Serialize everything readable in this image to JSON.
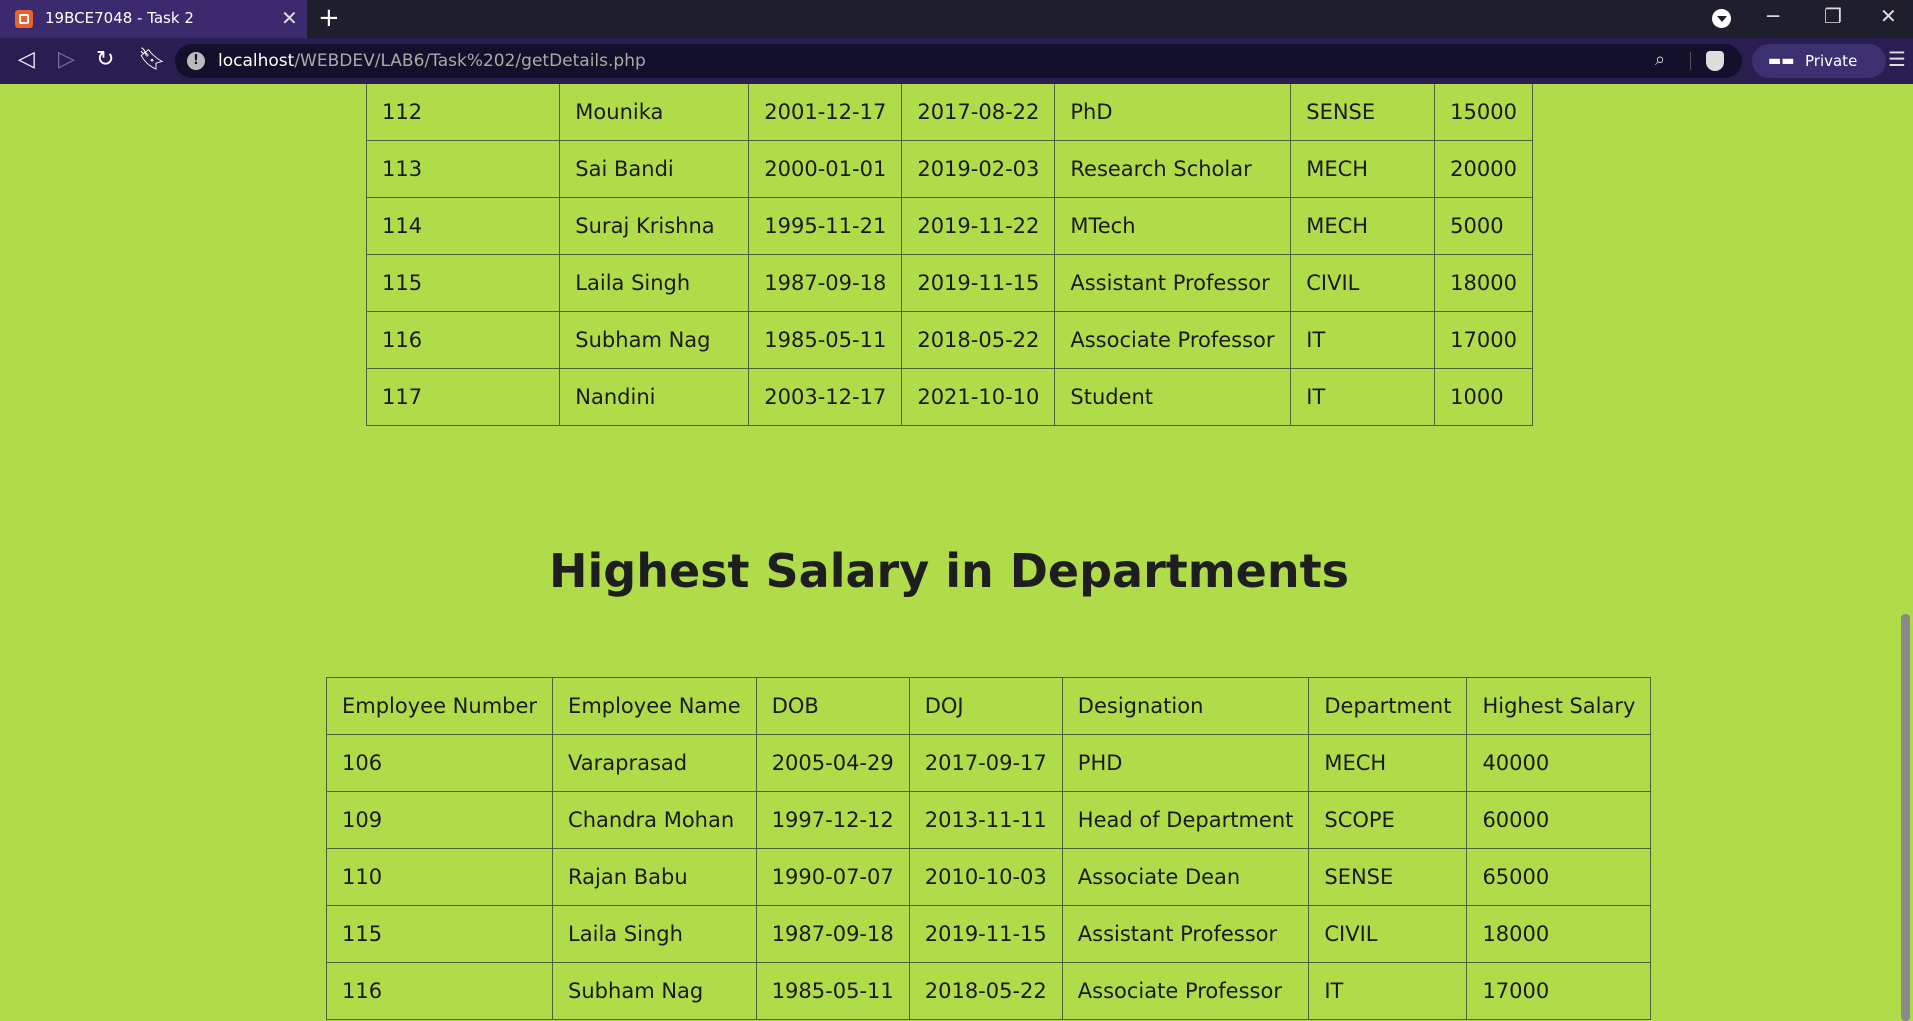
{
  "browser": {
    "tab_title": "19BCE7048 - Task 2",
    "url_host": "localhost",
    "url_path": "/WEBDEV/LAB6/Task%202/getDetails.php",
    "private_label": "Private"
  },
  "page": {
    "table1_rows": [
      [
        "112",
        "Mounika",
        "2001-12-17",
        "2017-08-22",
        "PhD",
        "SENSE",
        "15000"
      ],
      [
        "113",
        "Sai Bandi",
        "2000-01-01",
        "2019-02-03",
        "Research Scholar",
        "MECH",
        "20000"
      ],
      [
        "114",
        "Suraj Krishna",
        "1995-11-21",
        "2019-11-22",
        "MTech",
        "MECH",
        "5000"
      ],
      [
        "115",
        "Laila Singh",
        "1987-09-18",
        "2019-11-15",
        "Assistant Professor",
        "CIVIL",
        "18000"
      ],
      [
        "116",
        "Subham Nag",
        "1985-05-11",
        "2018-05-22",
        "Associate Professor",
        "IT",
        "17000"
      ],
      [
        "117",
        "Nandini",
        "2003-12-17",
        "2021-10-10",
        "Student",
        "IT",
        "1000"
      ]
    ],
    "heading": "Highest Salary in Departments",
    "table2_headers": [
      "Employee Number",
      "Employee Name",
      "DOB",
      "DOJ",
      "Designation",
      "Department",
      "Highest Salary"
    ],
    "table2_rows": [
      [
        "106",
        "Varaprasad",
        "2005-04-29",
        "2017-09-17",
        "PHD",
        "MECH",
        "40000"
      ],
      [
        "109",
        "Chandra Mohan",
        "1997-12-12",
        "2013-11-11",
        "Head of Department",
        "SCOPE",
        "60000"
      ],
      [
        "110",
        "Rajan Babu",
        "1990-07-07",
        "2010-10-03",
        "Associate Dean",
        "SENSE",
        "65000"
      ],
      [
        "115",
        "Laila Singh",
        "1987-09-18",
        "2019-11-15",
        "Assistant Professor",
        "CIVIL",
        "18000"
      ],
      [
        "116",
        "Subham Nag",
        "1985-05-11",
        "2018-05-22",
        "Associate Professor",
        "IT",
        "17000"
      ]
    ]
  }
}
